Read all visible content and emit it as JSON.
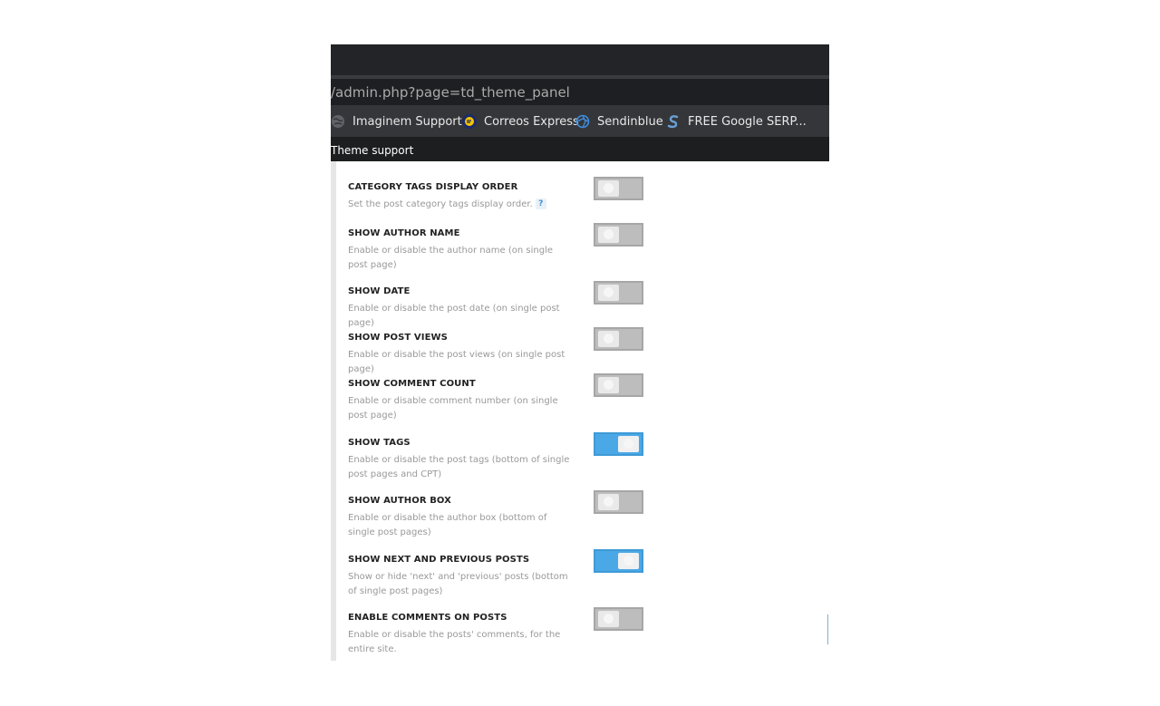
{
  "browser": {
    "url": "/admin.php?page=td_theme_panel",
    "bookmarks": [
      {
        "label": "Imaginem Support...",
        "icon": "globe-icon"
      },
      {
        "label": "Correos Express",
        "icon": "correos-logo-icon"
      },
      {
        "label": "Sendinblue",
        "icon": "sendinblue-logo-icon"
      },
      {
        "label": "FREE Google SERP...",
        "icon": "serp-s-logo-icon"
      }
    ],
    "theme_support_label": "Theme support"
  },
  "colors": {
    "toggle_on": "#4ba8e6",
    "toggle_off": "#bdbdbd"
  },
  "settings": [
    {
      "title": "CATEGORY TAGS DISPLAY ORDER",
      "desc": "Set the post category tags display order.",
      "help": "?",
      "enabled": false
    },
    {
      "title": "SHOW AUTHOR NAME",
      "desc": "Enable or disable the author name (on single post page)",
      "enabled": false
    },
    {
      "title": "SHOW DATE",
      "desc": "Enable or disable the post date (on single post page)",
      "enabled": false
    },
    {
      "title": "SHOW POST VIEWS",
      "desc": "Enable or disable the post views (on single post page)",
      "enabled": false
    },
    {
      "title": "SHOW COMMENT COUNT",
      "desc": "Enable or disable comment number (on single post page)",
      "enabled": false
    },
    {
      "title": "SHOW TAGS",
      "desc": "Enable or disable the post tags (bottom of single post pages and CPT)",
      "enabled": true
    },
    {
      "title": "SHOW AUTHOR BOX",
      "desc": "Enable or disable the author box (bottom of single post pages)",
      "enabled": false
    },
    {
      "title": "SHOW NEXT AND PREVIOUS POSTS",
      "desc": "Show or hide 'next' and 'previous' posts (bottom of single post pages)",
      "enabled": true
    },
    {
      "title": "ENABLE COMMENTS ON POSTS",
      "desc": "Enable or disable the posts' comments, for the entire site.",
      "enabled": false
    }
  ]
}
